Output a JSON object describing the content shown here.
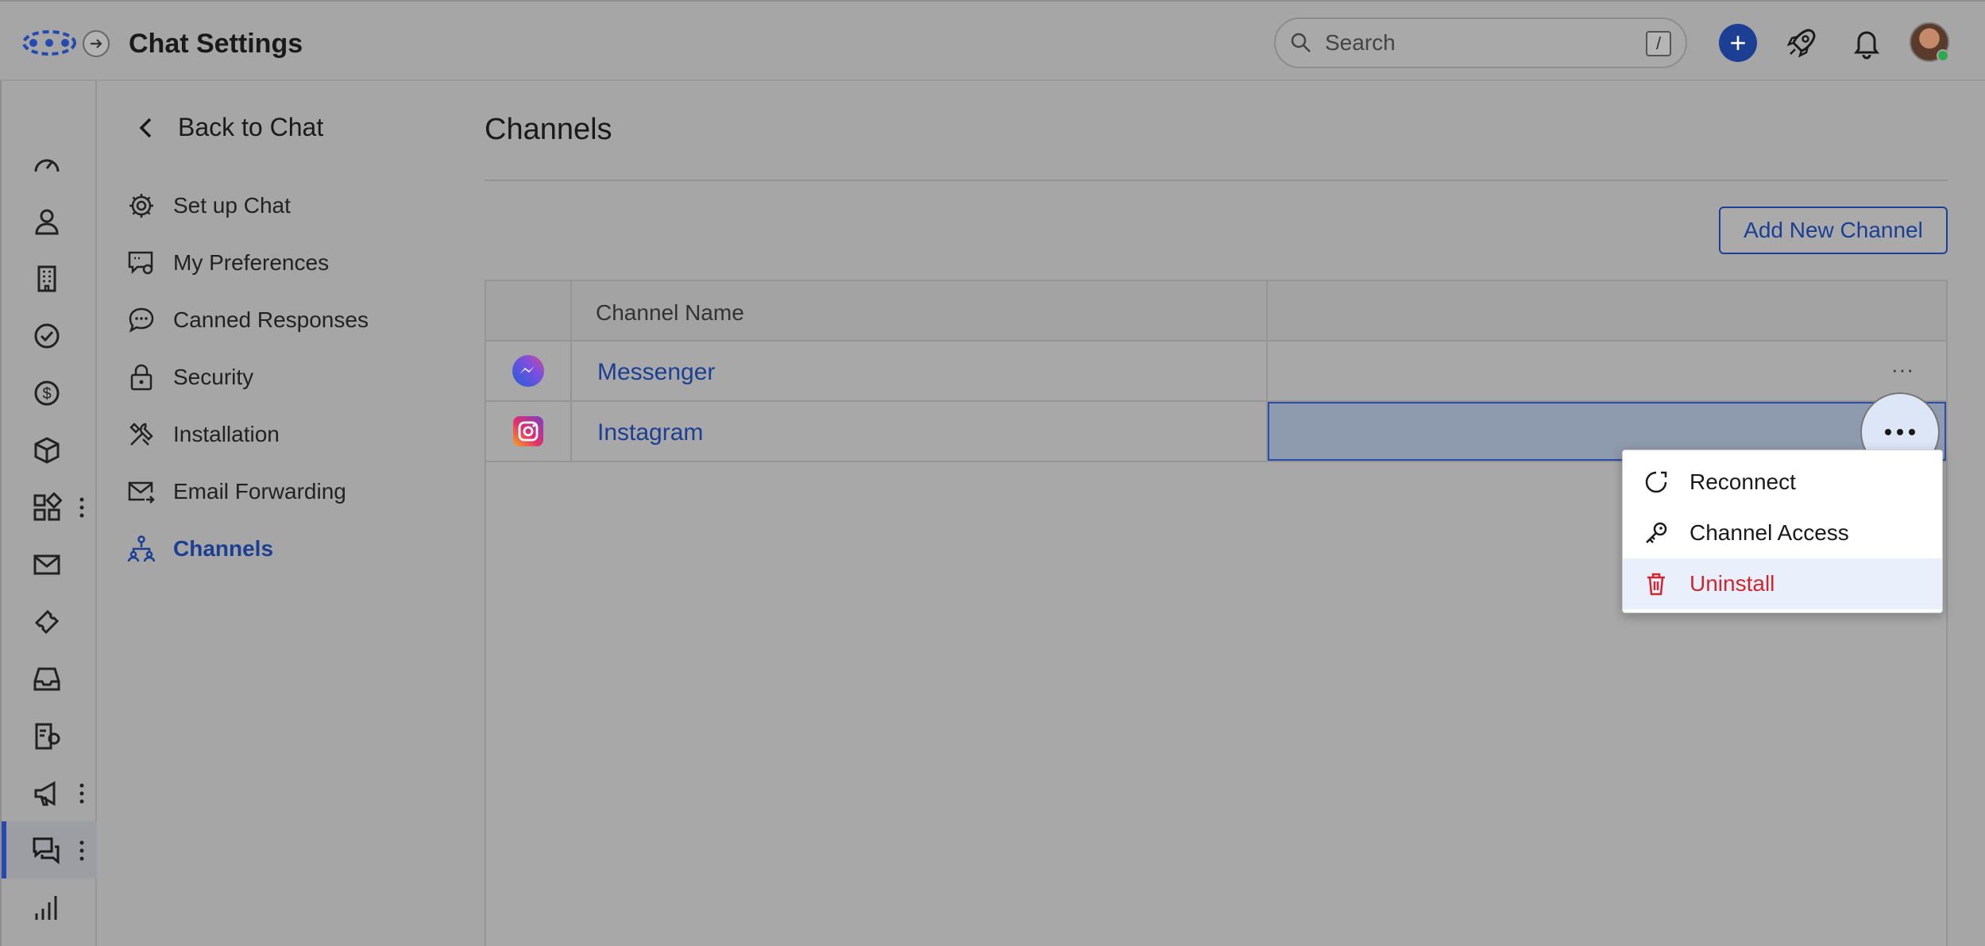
{
  "header": {
    "title": "Chat Settings",
    "search_placeholder": "Search",
    "search_shortcut": "/",
    "create_label": "+"
  },
  "sidebar": {
    "back_label": "Back to Chat",
    "items": [
      {
        "label": "Set up Chat",
        "icon": "gear-icon"
      },
      {
        "label": "My Preferences",
        "icon": "chat-settings-icon"
      },
      {
        "label": "Canned Responses",
        "icon": "chat-bubble-icon"
      },
      {
        "label": "Security",
        "icon": "lock-icon"
      },
      {
        "label": "Installation",
        "icon": "tools-icon"
      },
      {
        "label": "Email Forwarding",
        "icon": "mail-forward-icon"
      },
      {
        "label": "Channels",
        "icon": "channels-icon",
        "active": true
      }
    ]
  },
  "rail": {
    "items": [
      "dashboard-icon",
      "contacts-icon",
      "companies-icon",
      "tasks-icon",
      "deals-icon",
      "products-icon",
      "apps-icon",
      "email-icon",
      "tickets-icon",
      "inbox-icon",
      "sequences-icon",
      "campaigns-icon",
      "chat-icon",
      "reports-icon",
      "more-icon"
    ],
    "active": "chat-icon"
  },
  "main": {
    "title": "Channels",
    "add_button": "Add New Channel",
    "table": {
      "header": "Channel Name",
      "rows": [
        {
          "name": "Messenger",
          "icon": "messenger-icon"
        },
        {
          "name": "Instagram",
          "icon": "instagram-icon"
        }
      ],
      "row_menu_glyph": "···"
    },
    "context_menu": {
      "items": [
        {
          "label": "Reconnect",
          "icon": "reconnect-icon"
        },
        {
          "label": "Channel Access",
          "icon": "key-icon"
        },
        {
          "label": "Uninstall",
          "icon": "trash-icon",
          "color": "#d0262f"
        }
      ]
    }
  },
  "colors": {
    "accent": "#1c3f94",
    "danger": "#d0262f",
    "overlay": "#a6a6a6"
  }
}
